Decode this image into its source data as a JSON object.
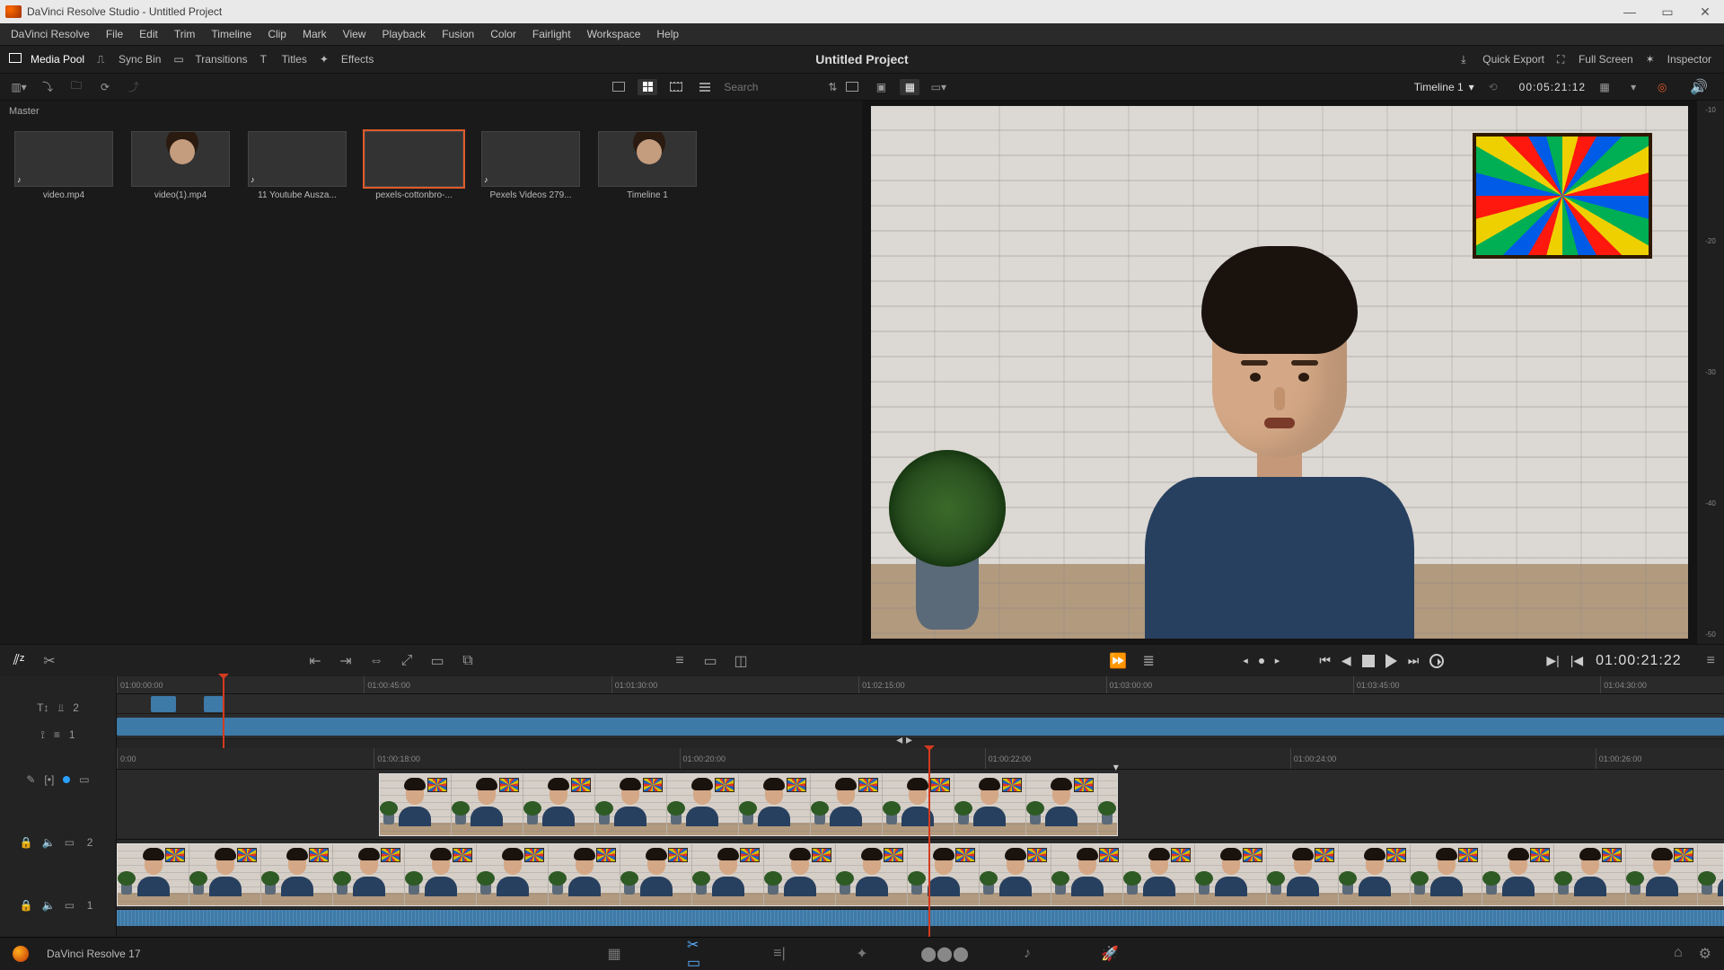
{
  "window": {
    "title": "DaVinci Resolve Studio - Untitled Project"
  },
  "menu": [
    "DaVinci Resolve",
    "File",
    "Edit",
    "Trim",
    "Timeline",
    "Clip",
    "Mark",
    "View",
    "Playback",
    "Fusion",
    "Color",
    "Fairlight",
    "Workspace",
    "Help"
  ],
  "toolbar": {
    "media_pool": "Media Pool",
    "sync_bin": "Sync Bin",
    "transitions": "Transitions",
    "titles": "Titles",
    "effects": "Effects",
    "project_title": "Untitled Project",
    "quick_export": "Quick Export",
    "full_screen": "Full Screen",
    "inspector": "Inspector"
  },
  "subtoolbar": {
    "search_placeholder": "Search",
    "timeline_name": "Timeline 1",
    "viewer_timecode": "00:05:21:12"
  },
  "media_pool": {
    "bin": "Master",
    "clips": [
      {
        "id": "c0",
        "label": "video.mp4",
        "thumb": "th-video",
        "audio": true,
        "selected": false
      },
      {
        "id": "c1",
        "label": "video(1).mp4",
        "thumb": "th-face",
        "audio": false,
        "selected": false
      },
      {
        "id": "c2",
        "label": "11 Youtube Ausza...",
        "thumb": "th-yt",
        "audio": true,
        "selected": false
      },
      {
        "id": "c3",
        "label": "pexels-cottonbro-...",
        "thumb": "th-skate",
        "audio": false,
        "selected": true
      },
      {
        "id": "c4",
        "label": "Pexels Videos 279...",
        "thumb": "th-legs",
        "audio": true,
        "selected": false
      },
      {
        "id": "c5",
        "label": "Timeline 1",
        "thumb": "th-face",
        "audio": false,
        "selected": false
      }
    ]
  },
  "audio_meter_ticks": [
    "-10",
    "-20",
    "-30",
    "-40",
    "-50"
  ],
  "transport": {
    "timecode": "01:00:21:22"
  },
  "upper_timeline": {
    "ruler": [
      "01:00:00:00",
      "01:00:45:00",
      "01:01:30:00",
      "01:02:15:00",
      "01:03:00:00",
      "01:03:45:00",
      "01:04:30:00"
    ],
    "v2_track_label": "2",
    "v1_track_label": "1",
    "playhead_percent": 6.6,
    "v2_clips": [
      {
        "start": 2.1,
        "width": 1.6
      },
      {
        "start": 5.4,
        "width": 1.25
      }
    ],
    "v1_clip": {
      "start": 0,
      "width": 100
    }
  },
  "lower_timeline": {
    "ruler": [
      "0:00",
      "01:00:18:00",
      "01:00:20:00",
      "01:00:22:00",
      "01:00:24:00",
      "01:00:26:00"
    ],
    "ruler_positions_pct": [
      0,
      16,
      35,
      54,
      73,
      92
    ],
    "playhead_percent": 50.5,
    "v2_track_label": "2",
    "v1_track_label": "1",
    "v2_clip": {
      "start_pct": 16.3,
      "width_pct": 46.0,
      "frames": 11
    },
    "v1_clip": {
      "start_pct": 0,
      "width_pct": 100,
      "frames": 24
    }
  },
  "footer": {
    "app_label": "DaVinci Resolve 17"
  }
}
